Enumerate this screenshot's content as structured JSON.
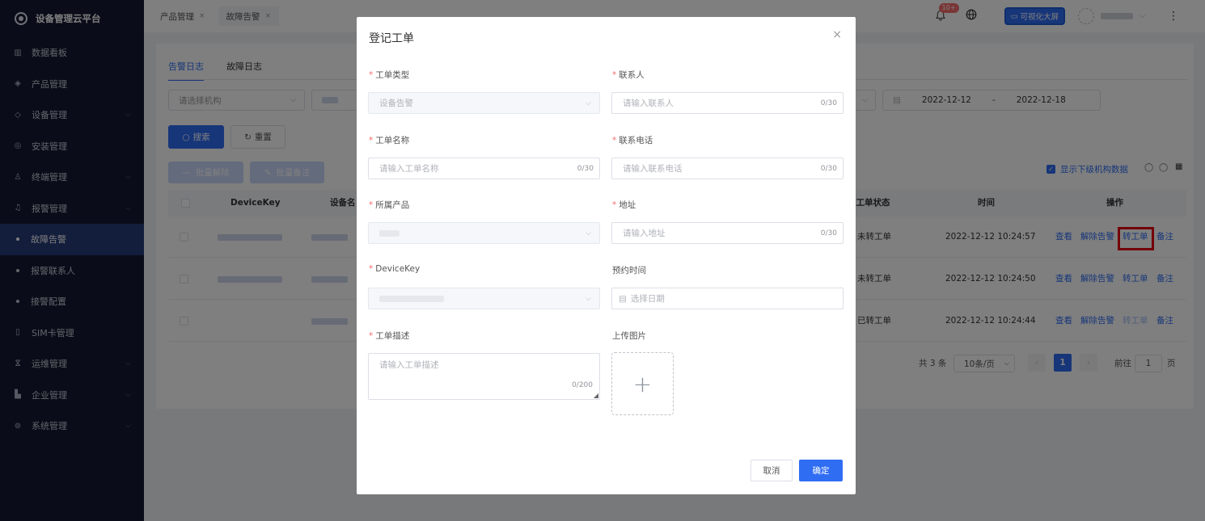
{
  "sidebar": {
    "brand": "设备管理云平台",
    "items": [
      {
        "label": "数据看板",
        "icon": "bar-chart-icon",
        "glyph": "▥",
        "chevron": false
      },
      {
        "label": "产品管理",
        "icon": "cube-icon",
        "glyph": "◈",
        "chevron": false
      },
      {
        "label": "设备管理",
        "icon": "layers-icon",
        "glyph": "◇",
        "chevron": true
      },
      {
        "label": "安装管理",
        "icon": "compass-icon",
        "glyph": "◎",
        "chevron": false
      },
      {
        "label": "终端管理",
        "icon": "person-icon",
        "glyph": "♙",
        "chevron": true
      },
      {
        "label": "报警管理",
        "icon": "alarm-icon",
        "glyph": "♫",
        "chevron": true
      }
    ],
    "subitems": [
      "故障告警",
      "报警联系人",
      "接警配置"
    ],
    "items2": [
      {
        "label": "SIM卡管理",
        "icon": "sim-icon",
        "glyph": "▯",
        "chevron": false
      },
      {
        "label": "运维管理",
        "icon": "wrench-icon",
        "glyph": "ⴵ",
        "chevron": true
      },
      {
        "label": "企业管理",
        "icon": "building-icon",
        "glyph": "▙",
        "chevron": true
      },
      {
        "label": "系统管理",
        "icon": "settings-icon",
        "glyph": "⊚",
        "chevron": true
      }
    ]
  },
  "topbar": {
    "tabs": [
      "产品管理",
      "故障告警"
    ],
    "badge": "10+",
    "vis_label": "可视化大屏"
  },
  "content": {
    "subtabs": [
      "告警日志",
      "故障日志"
    ],
    "org_placeholder": "请选择机构",
    "date_start": "2022-12-12",
    "date_sep": "-",
    "date_end": "2022-12-18",
    "search": "搜索",
    "reset": "重置",
    "batch_release": "批量解除",
    "batch_note": "批量备注",
    "show_sub": "显示下级机构数据",
    "columns": {
      "devicekey": "DeviceKey",
      "devname": "设备名",
      "status": "转工单状态",
      "time": "时间",
      "ops": "操作"
    },
    "rows": [
      {
        "status": "未转工单",
        "time": "2022-12-12 10:24:57"
      },
      {
        "status": "未转工单",
        "time": "2022-12-12 10:24:50"
      },
      {
        "status": "已转工单",
        "time": "2022-12-12 10:24:44"
      }
    ],
    "ops": {
      "view": "查看",
      "release": "解除告警",
      "transfer": "转工单",
      "note": "备注"
    },
    "pager": {
      "total": "共 3 条",
      "size": "10条/页",
      "page": "1",
      "goto": "前往",
      "goto_val": "1",
      "unit": "页"
    }
  },
  "modal": {
    "title": "登记工单",
    "labels": {
      "type": "工单类型",
      "contact": "联系人",
      "name": "工单名称",
      "phone": "联系电话",
      "product": "所属产品",
      "address": "地址",
      "devicekey": "DeviceKey",
      "appointment": "预约时间",
      "desc": "工单描述",
      "upload": "上传图片"
    },
    "values": {
      "type": "设备告警"
    },
    "placeholders": {
      "contact": "请输入联系人",
      "name": "请输入工单名称",
      "phone": "请输入联系电话",
      "address": "请输入地址",
      "date": "选择日期",
      "desc": "请输入工单描述"
    },
    "counts": {
      "c30": "0/30",
      "c200": "0/200"
    },
    "cancel": "取消",
    "ok": "确定"
  }
}
